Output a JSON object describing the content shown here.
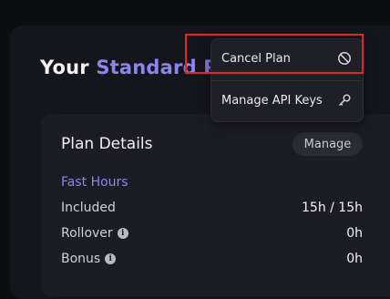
{
  "header": {
    "title_prefix": "Your ",
    "title_plan": "Standard Plan"
  },
  "plan_details": {
    "title": "Plan Details",
    "manage_label": "Manage",
    "section_label": "Fast Hours",
    "rows": [
      {
        "label": "Included",
        "value": "15h / 15h",
        "info": false
      },
      {
        "label": "Rollover",
        "value": "0h",
        "info": true
      },
      {
        "label": "Bonus",
        "value": "0h",
        "info": true
      }
    ]
  },
  "dropdown": {
    "items": [
      {
        "label": "Cancel Plan",
        "icon": "ban-icon"
      },
      {
        "label": "Manage API Keys",
        "icon": "key-icon"
      }
    ]
  },
  "colors": {
    "accent": "#8b86ee",
    "highlight": "#e1262b",
    "background": "#0c0d11"
  }
}
